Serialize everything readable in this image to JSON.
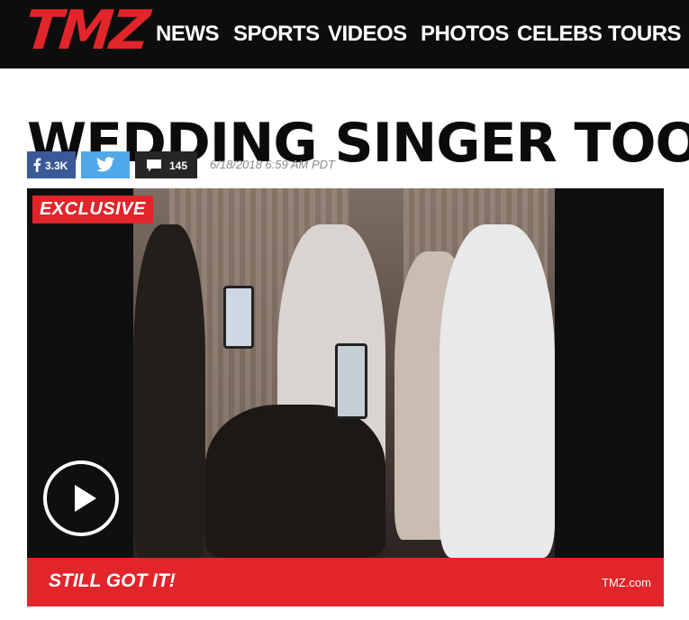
{
  "header": {
    "logo_text": "TMZ",
    "nav": [
      "NEWS",
      "SPORTS",
      "VIDEOS",
      "PHOTOS",
      "CELEBS",
      "TOURS"
    ],
    "accent_color": "#e1252b",
    "background_color": "#0d0d0d"
  },
  "article": {
    "headline": "WEDDING SINGER TOO",
    "share": {
      "facebook_count": "3.3K",
      "comments_count": "145"
    },
    "date": "6/18/2018 6:59 AM PDT"
  },
  "video": {
    "badge": "EXCLUSIVE",
    "caption": "STILL GOT IT!",
    "source": "TMZ.com",
    "icons": [
      "facebook-icon",
      "twitter-icon",
      "comment-icon",
      "play-icon"
    ]
  }
}
